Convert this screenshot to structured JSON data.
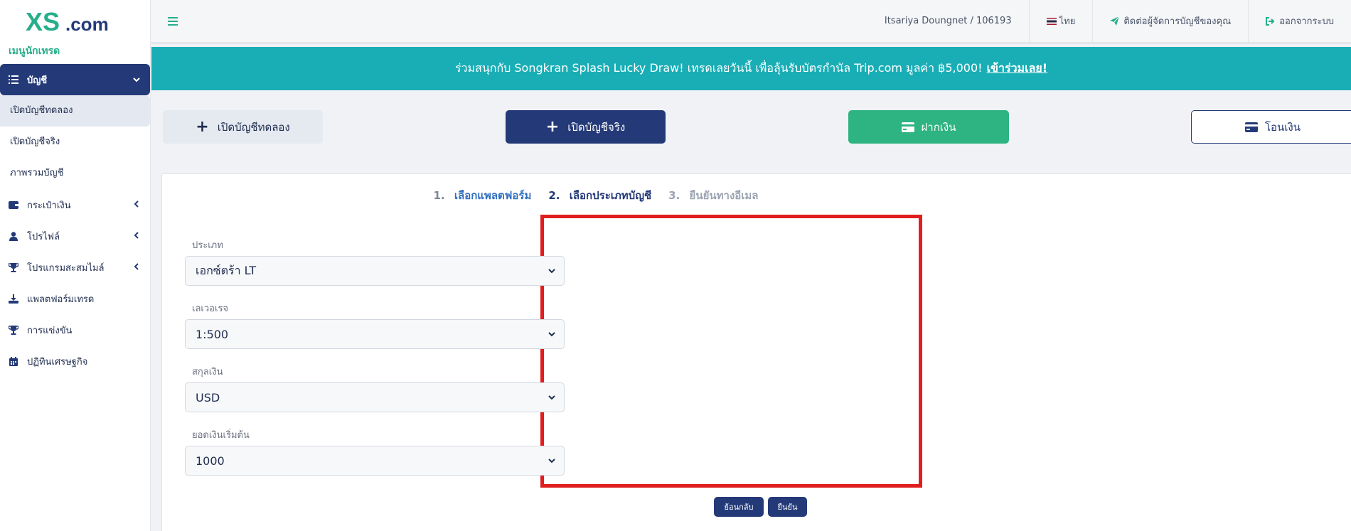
{
  "brand": {
    "logo_text": "XS.com",
    "accent": "#27ae8a",
    "navy": "#243a78",
    "teal": "#19aeb6"
  },
  "sidebar": {
    "heading": "เมนูนักเทรด",
    "account_menu": {
      "label": "บัญชี",
      "icon": "list-icon"
    },
    "account_subitems": [
      {
        "label": "เปิดบัญชีทดลอง"
      },
      {
        "label": "เปิดบัญชีจริง"
      },
      {
        "label": "ภาพรวมบัญชี"
      }
    ],
    "items": [
      {
        "label": "กระเป๋าเงิน",
        "icon": "wallet-icon"
      },
      {
        "label": "โปรไฟล์",
        "icon": "user-icon"
      },
      {
        "label": "โปรแกรมสะสมไมล์",
        "icon": "trophy-icon"
      },
      {
        "label": "แพลตฟอร์มเทรด",
        "icon": "download-icon"
      },
      {
        "label": "การแข่งขัน",
        "icon": "trophy-icon"
      },
      {
        "label": "ปฏิทินเศรษฐกิจ",
        "icon": "calendar-icon"
      }
    ]
  },
  "topbar": {
    "user": "Itsariya Doungnet / 106193",
    "language": "ไทย",
    "contact": "ติดต่อผู้จัดการบัญชีของคุณ",
    "logout": "ออกจากระบบ"
  },
  "banner": {
    "text": "ร่วมสนุกกับ Songkran Splash Lucky Draw! เทรดเลยวันนี้ เพื่อลุ้นรับบัตรกำนัล Trip.com มูลค่า ฿5,000!",
    "cta": "เข้าร่วมเลย!"
  },
  "actions": {
    "demo": "เปิดบัญชีทดลอง",
    "real": "เปิดบัญชีจริง",
    "deposit": "ฝากเงิน",
    "transfer": "โอนเงิน"
  },
  "steps": [
    {
      "num": "1.",
      "label": "เลือกแพลตฟอร์ม"
    },
    {
      "num": "2.",
      "label": "เลือกประเภทบัญชี"
    },
    {
      "num": "3.",
      "label": "ยืนยันทางอีเมล"
    }
  ],
  "form": {
    "type": {
      "label": "ประเภท",
      "value": "เอกซ์ตร้า LT"
    },
    "leverage": {
      "label": "เลเวอเรจ",
      "value": "1:500"
    },
    "currency": {
      "label": "สกุลเงิน",
      "value": "USD"
    },
    "initial_balance": {
      "label": "ยอดเงินเริ่มต้น",
      "value": "1000"
    }
  },
  "buttons": {
    "back": "ย้อนกลับ",
    "confirm": "ยืนยัน"
  }
}
